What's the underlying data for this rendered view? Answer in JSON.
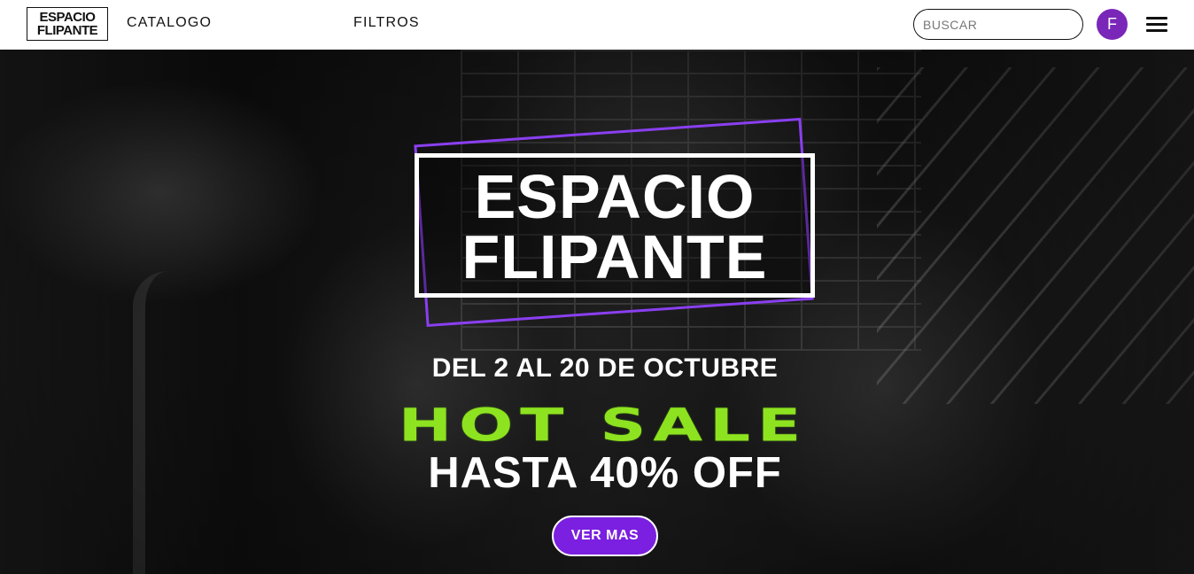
{
  "navbar": {
    "logo_line1": "ESPACIO",
    "logo_line2": "FLIPANTE",
    "links": [
      "CATALOGO",
      "FILTROS"
    ],
    "search_placeholder": "BUSCAR",
    "avatar_initial": "F",
    "menu_icon": "hamburger-menu-icon"
  },
  "hero": {
    "brand_line1": "ESPACIO",
    "brand_line2": "FLIPANTE",
    "date_text": "DEL 2 AL 20 DE OCTUBRE",
    "sale_title": "HOT SALE",
    "discount_text": "HASTA 40% OFF",
    "cta_label": "VER MAS"
  },
  "colors": {
    "accent_purple": "#7b1fe0",
    "sale_green": "#8ee320",
    "avatar_bg": "#7a26b8"
  }
}
